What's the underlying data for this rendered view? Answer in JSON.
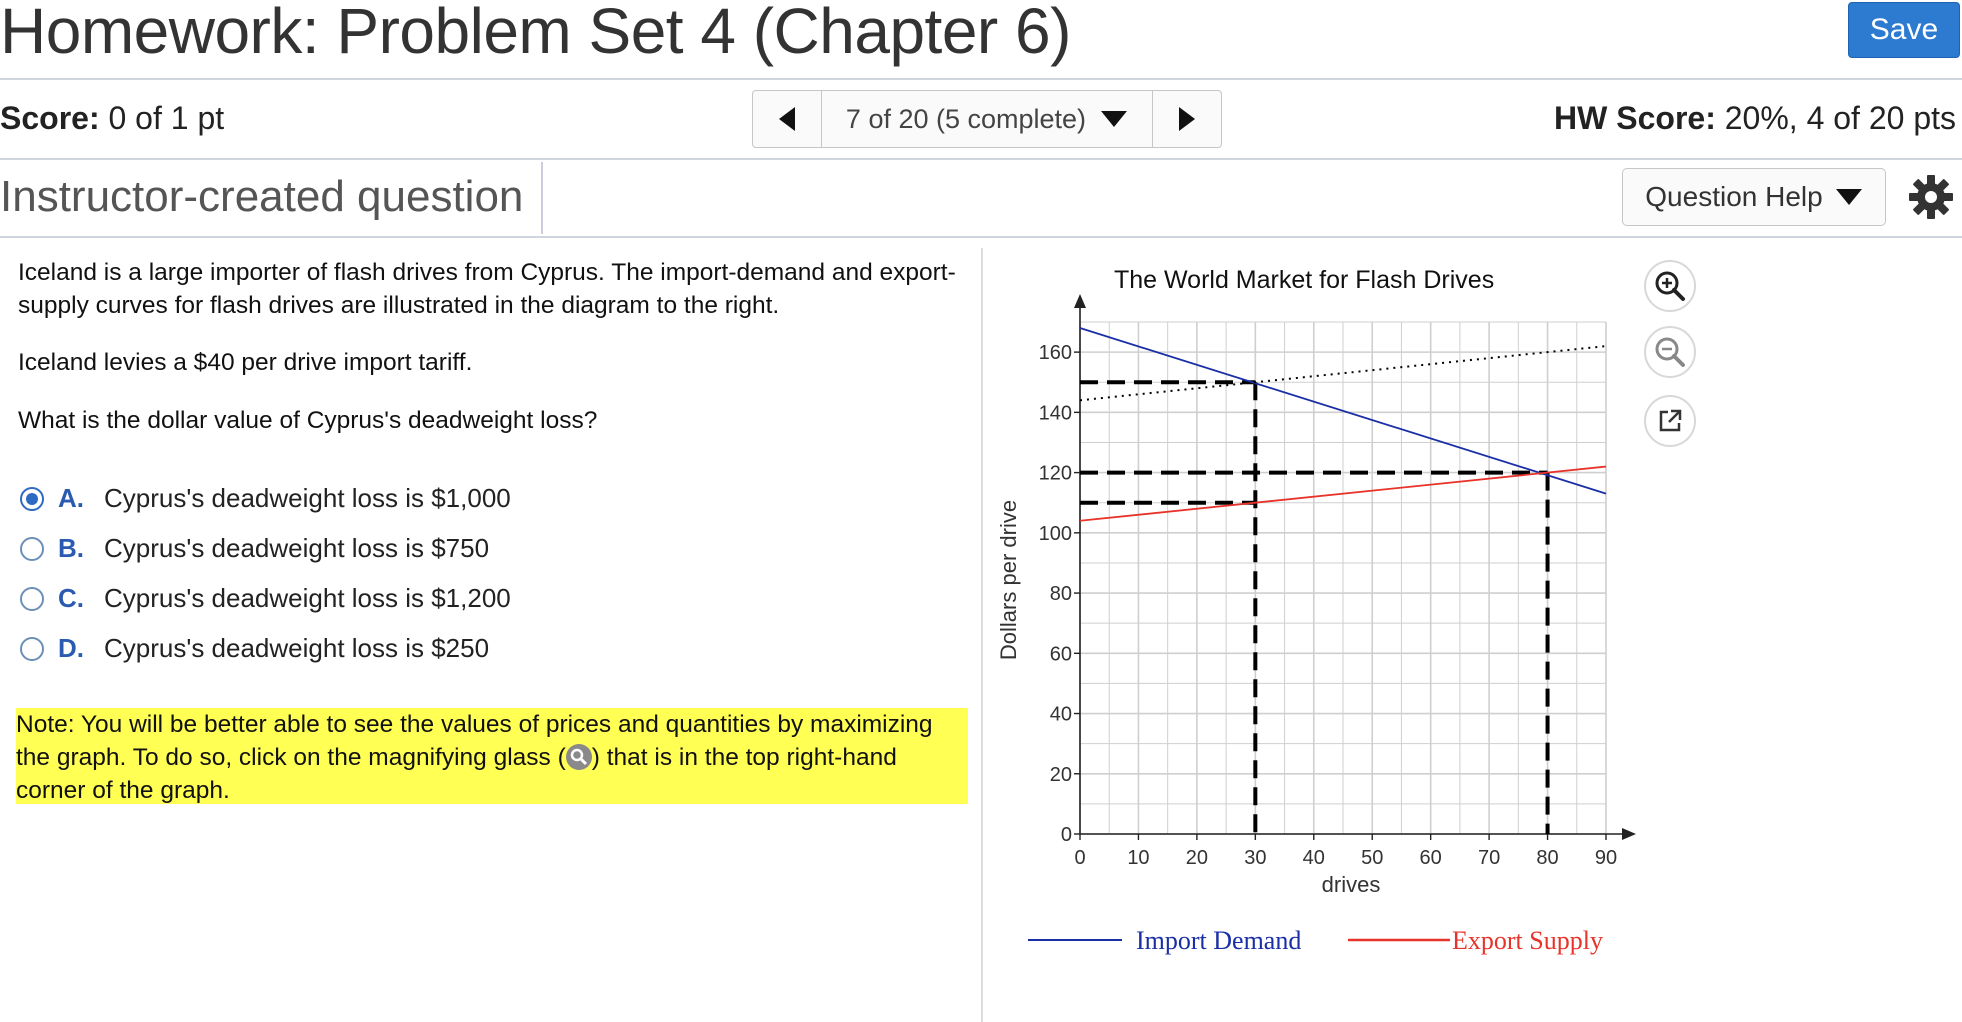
{
  "header": {
    "title": "Homework: Problem Set 4 (Chapter 6)",
    "save_label": "Save",
    "score_label": "Score:",
    "score_value": "0 of 1 pt",
    "nav_text": "7 of 20 (5 complete)",
    "hw_score_label": "HW Score:",
    "hw_score_value": "20%, 4 of 20 pts",
    "question_type": "Instructor-created question",
    "question_help": "Question Help"
  },
  "question": {
    "para1": "Iceland is a large importer of flash drives from Cyprus.  The import-demand and export-supply curves for flash drives are illustrated in the diagram to the right.",
    "para2": "Iceland levies a $40 per drive import tariff.",
    "para3": "What is the dollar value of Cyprus's deadweight loss?",
    "choices": [
      {
        "letter": "A.",
        "text": "Cyprus's deadweight loss is $1,000",
        "selected": true
      },
      {
        "letter": "B.",
        "text": "Cyprus's deadweight loss is $750",
        "selected": false
      },
      {
        "letter": "C.",
        "text": "Cyprus's deadweight loss is $1,200",
        "selected": false
      },
      {
        "letter": "D.",
        "text": "Cyprus's deadweight loss is $250",
        "selected": false
      }
    ],
    "note_before": "Note:  You will be better able to see the values of prices and quantities by maximizing the graph.  To do so, click on the magnifying glass (",
    "note_after": ") that is in the top right-hand corner of the graph."
  },
  "graph": {
    "title": "The World Market for Flash Drives",
    "tools": [
      "zoom-in-icon",
      "zoom-out-icon",
      "popout-icon"
    ]
  },
  "chart_data": {
    "type": "line",
    "title": "The World Market for Flash Drives",
    "xlabel": "drives",
    "ylabel": "Dollars per drive",
    "xlim": [
      0,
      90
    ],
    "ylim": [
      0,
      170
    ],
    "xticks": [
      0,
      10,
      20,
      30,
      40,
      50,
      60,
      70,
      80,
      90
    ],
    "yticks": [
      0,
      20,
      40,
      60,
      80,
      100,
      120,
      140,
      160
    ],
    "grid": true,
    "series": [
      {
        "name": "Import Demand",
        "color": "#1a2fa6",
        "x": [
          0,
          90
        ],
        "y": [
          168,
          113
        ]
      },
      {
        "name": "Export Supply",
        "color": "#e8332a",
        "x": [
          0,
          90
        ],
        "y": [
          104,
          122
        ]
      },
      {
        "name": "",
        "color": "#000000",
        "style": "dotted",
        "x": [
          0,
          90
        ],
        "y": [
          144,
          162
        ]
      }
    ],
    "reference_lines": {
      "horizontal": [
        {
          "y": 150,
          "x_to": 30
        },
        {
          "y": 120,
          "x_to": 80
        },
        {
          "y": 110,
          "x_to": 30
        }
      ],
      "vertical": [
        {
          "x": 30,
          "y_to": 150
        },
        {
          "x": 80,
          "y_to": 120
        }
      ]
    },
    "legend_position": "bottom"
  }
}
